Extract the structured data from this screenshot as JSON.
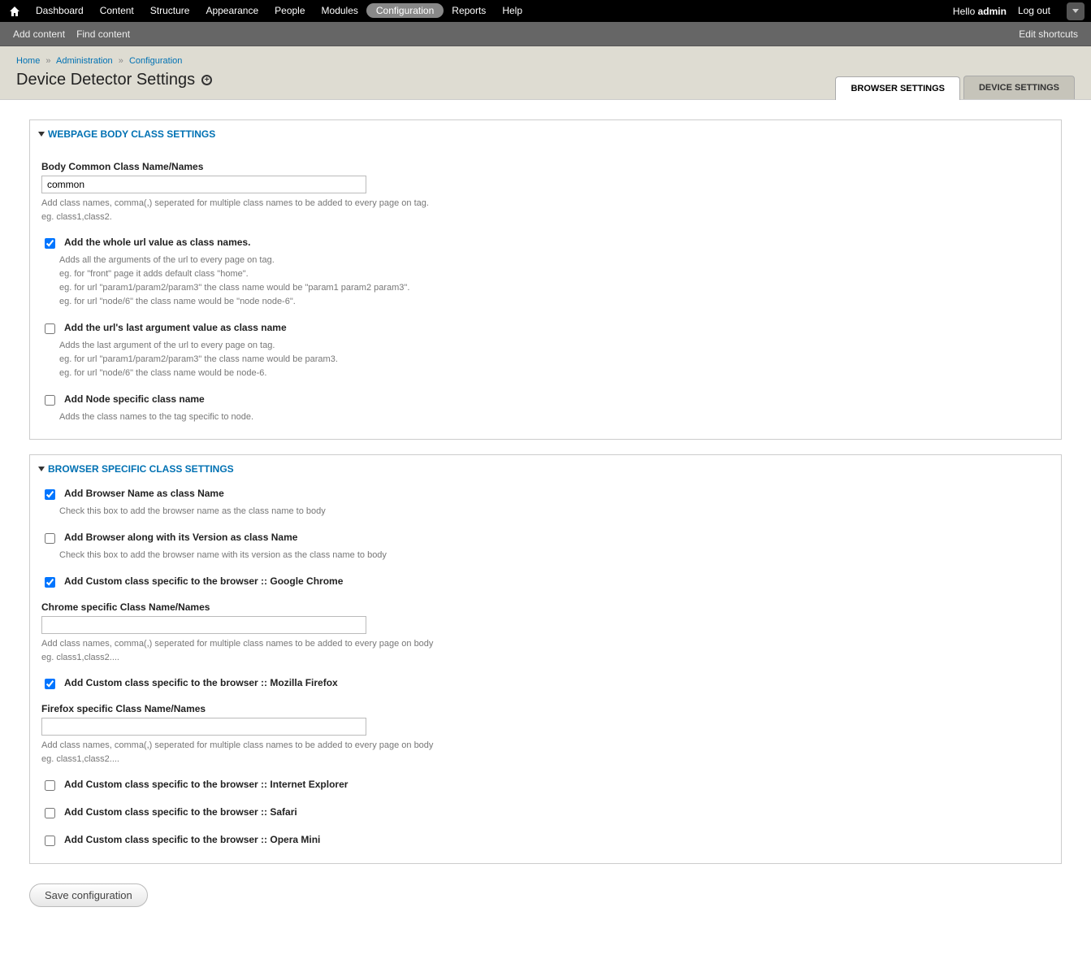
{
  "top_menu": {
    "items": [
      "Dashboard",
      "Content",
      "Structure",
      "Appearance",
      "People",
      "Modules",
      "Configuration",
      "Reports",
      "Help"
    ],
    "active_index": 6
  },
  "user": {
    "greeting": "Hello",
    "name": "admin",
    "logout": "Log out"
  },
  "sub_toolbar": {
    "left": [
      "Add content",
      "Find content"
    ],
    "right": "Edit shortcuts"
  },
  "breadcrumb": [
    {
      "label": "Home",
      "link": true
    },
    {
      "label": "Administration",
      "link": true
    },
    {
      "label": "Configuration",
      "link": true
    }
  ],
  "breadcrumb_sep": "»",
  "page_title": "Device Detector Settings",
  "tabs": [
    {
      "label": "BROWSER SETTINGS",
      "active": true
    },
    {
      "label": "DEVICE SETTINGS",
      "active": false
    }
  ],
  "fs1": {
    "legend": "WEBPAGE BODY CLASS SETTINGS",
    "body_class_label": "Body Common Class Name/Names",
    "body_class_value": "common",
    "body_class_desc": "Add class names, comma(,) seperated for multiple class names to be added to every page on tag.\neg. class1,class2.",
    "cb_whole_url": {
      "label": "Add the whole url value as class names.",
      "checked": true,
      "desc": "Adds all the arguments of the url to every page on tag.\neg. for \"front\" page it adds default class \"home\".\neg. for url \"param1/param2/param3\" the class name would be \"param1 param2 param3\".\neg. for url \"node/6\" the class name would be \"node node-6\"."
    },
    "cb_last_arg": {
      "label": "Add the url's last argument value as class name",
      "checked": false,
      "desc": "Adds the last argument of the url to every page on tag.\neg. for url \"param1/param2/param3\" the class name would be param3.\neg. for url \"node/6\" the class name would be node-6."
    },
    "cb_node": {
      "label": "Add Node specific class name",
      "checked": false,
      "desc": "Adds the class names to the tag specific to node."
    }
  },
  "fs2": {
    "legend": "BROWSER SPECIFIC CLASS SETTINGS",
    "cb_browser_name": {
      "label": "Add Browser Name as class Name",
      "checked": true,
      "desc": "Check this box to add the browser name as the class name to body"
    },
    "cb_browser_ver": {
      "label": "Add Browser along with its Version as class Name",
      "checked": false,
      "desc": "Check this box to add the browser name with its version as the class name to body"
    },
    "cb_chrome": {
      "label": "Add Custom class specific to the browser :: Google Chrome",
      "checked": true
    },
    "chrome_label": "Chrome specific Class Name/Names",
    "chrome_value": "",
    "chrome_desc": "Add class names, comma(,) seperated for multiple class names to be added to every page on body\neg. class1,class2....",
    "cb_firefox": {
      "label": "Add Custom class specific to the browser :: Mozilla Firefox",
      "checked": true
    },
    "firefox_label": "Firefox specific Class Name/Names",
    "firefox_value": "",
    "firefox_desc": "Add class names, comma(,) seperated for multiple class names to be added to every page on body\neg. class1,class2....",
    "cb_ie": {
      "label": "Add Custom class specific to the browser :: Internet Explorer",
      "checked": false
    },
    "cb_safari": {
      "label": "Add Custom class specific to the browser :: Safari",
      "checked": false
    },
    "cb_opera": {
      "label": "Add Custom class specific to the browser :: Opera Mini",
      "checked": false
    }
  },
  "save_button": "Save configuration"
}
